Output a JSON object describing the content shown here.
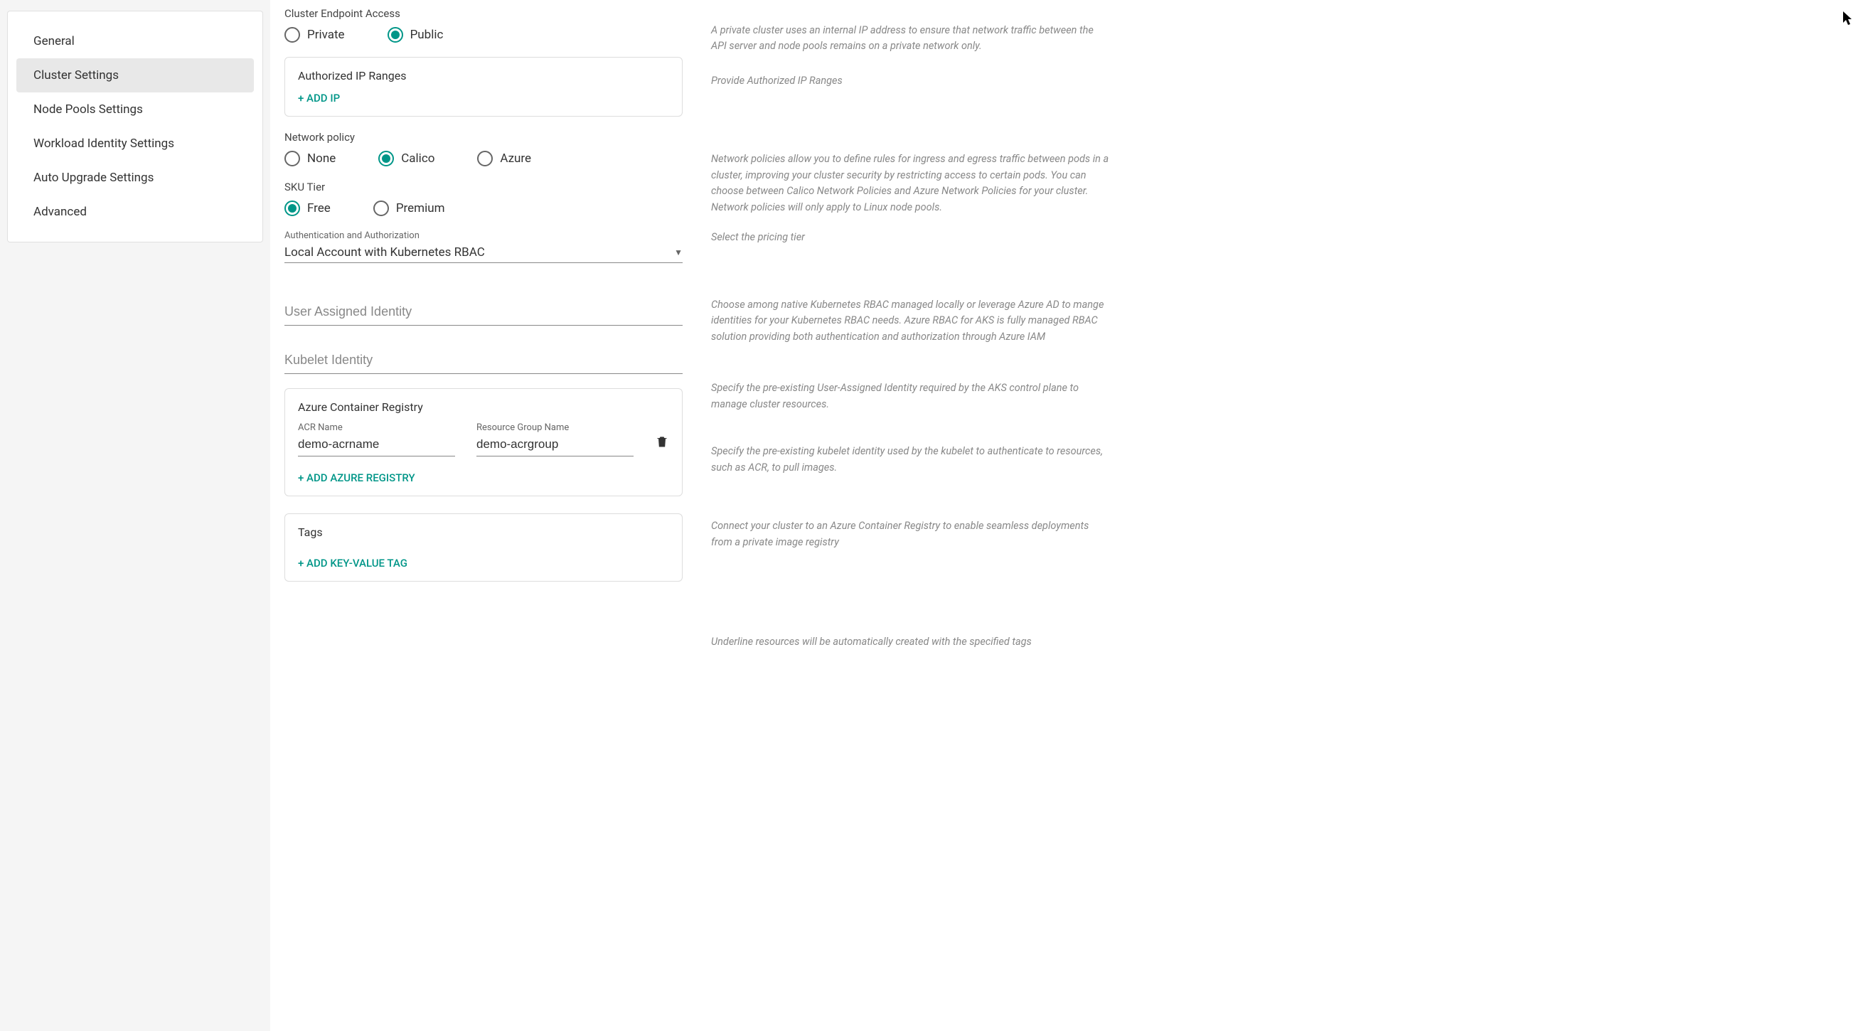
{
  "sidebar": {
    "items": [
      {
        "label": "General"
      },
      {
        "label": "Cluster Settings"
      },
      {
        "label": "Node Pools Settings"
      },
      {
        "label": "Workload Identity Settings"
      },
      {
        "label": "Auto Upgrade Settings"
      },
      {
        "label": "Advanced"
      }
    ],
    "active_index": 1
  },
  "cluster_endpoint": {
    "label": "Cluster Endpoint Access",
    "options": [
      {
        "label": "Private"
      },
      {
        "label": "Public"
      }
    ],
    "selected_index": 1,
    "help": "A private cluster uses an internal IP address to ensure that network traffic between the API server and node pools remains on a private network only."
  },
  "authorized_ip": {
    "title": "Authorized IP Ranges",
    "add_label": "+ ADD  IP",
    "help": "Provide Authorized IP Ranges"
  },
  "network_policy": {
    "label": "Network policy",
    "options": [
      {
        "label": "None"
      },
      {
        "label": "Calico"
      },
      {
        "label": "Azure"
      }
    ],
    "selected_index": 1,
    "help": "Network policies allow you to define rules for ingress and egress traffic between pods in a cluster, improving your cluster security by restricting access to certain pods. You can choose between Calico Network Policies and Azure Network Policies for your cluster. Network policies will only apply to Linux node pools."
  },
  "sku_tier": {
    "label": "SKU Tier",
    "options": [
      {
        "label": "Free"
      },
      {
        "label": "Premium"
      }
    ],
    "selected_index": 0,
    "help": "Select the pricing tier"
  },
  "auth": {
    "label": "Authentication and Authorization",
    "value": "Local Account with Kubernetes RBAC",
    "help": "Choose among native Kubernetes RBAC managed locally or leverage Azure AD to mange identities for your Kubernetes RBAC needs. Azure RBAC for AKS is fully managed RBAC solution providing both authentication and authorization through Azure IAM"
  },
  "user_assigned_identity": {
    "placeholder": "User Assigned Identity",
    "help": "Specify the pre-existing User-Assigned Identity required by the AKS control plane to manage cluster resources."
  },
  "kubelet_identity": {
    "placeholder": "Kubelet Identity",
    "help": "Specify the pre-existing kubelet identity used by the kubelet to authenticate to resources, such as ACR, to pull images."
  },
  "acr": {
    "title": "Azure Container Registry",
    "name_label": "ACR Name",
    "name_value": "demo-acrname",
    "group_label": "Resource Group Name",
    "group_value": "demo-acrgroup",
    "add_label": "+ ADD AZURE REGISTRY",
    "help": "Connect your cluster to an Azure Container Registry to enable seamless deployments from a private image registry"
  },
  "tags": {
    "title": "Tags",
    "add_label": "+ ADD KEY-VALUE TAG",
    "help": "Underline resources will be automatically created with the specified tags"
  }
}
